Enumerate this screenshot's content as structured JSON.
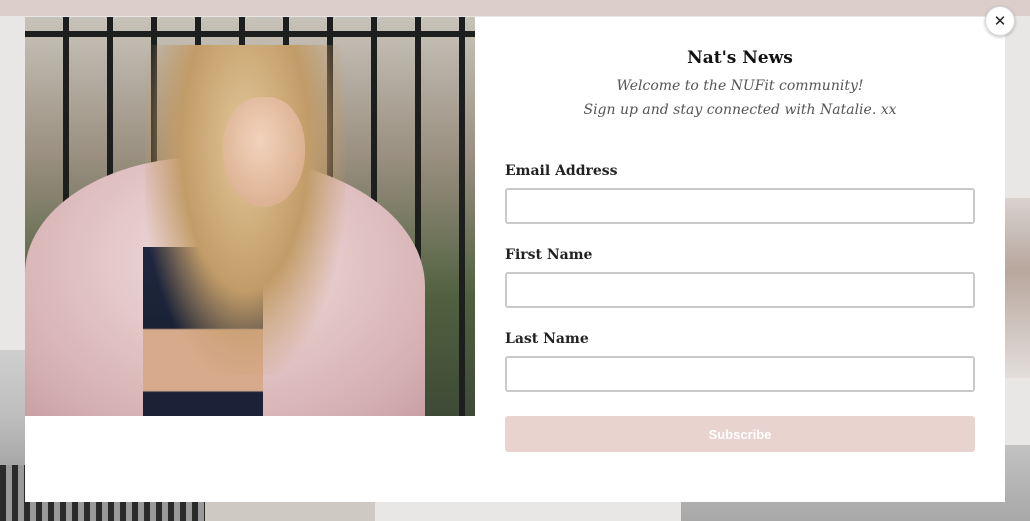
{
  "modal": {
    "close_symbol": "✕",
    "title": "Nat's News",
    "subtitle_lines": [
      "Welcome to the NUFit community!",
      "Sign up and stay connected with Natalie. xx"
    ],
    "fields": [
      {
        "label": "Email Address",
        "value": "",
        "placeholder": ""
      },
      {
        "label": "First Name",
        "value": "",
        "placeholder": ""
      },
      {
        "label": "Last Name",
        "value": "",
        "placeholder": ""
      }
    ],
    "subscribe_label": "Subscribe"
  },
  "colors": {
    "accent_button": "#e8d3cf",
    "top_bar": "#dccfcb",
    "input_border": "#c9c9c9"
  }
}
